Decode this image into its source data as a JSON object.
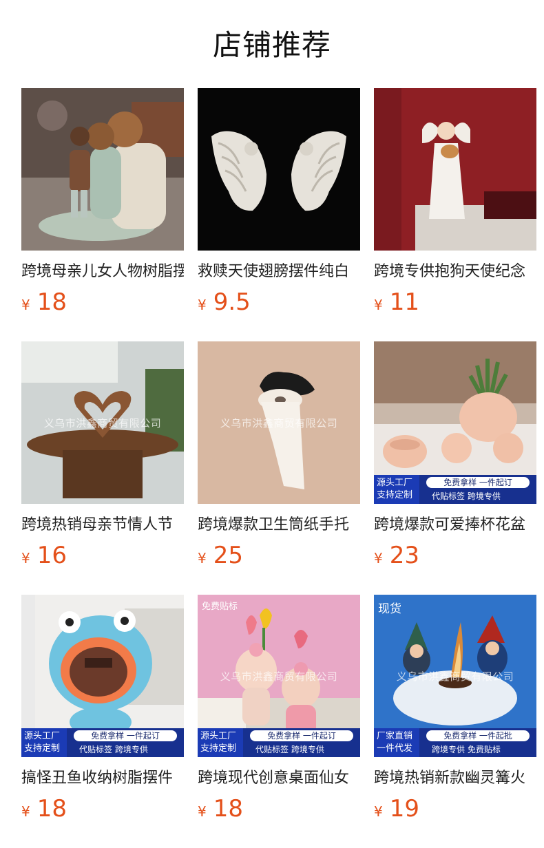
{
  "header": {
    "title": "店铺推荐"
  },
  "currency": "¥",
  "products": [
    {
      "title": "跨境母亲儿女人物树脂摆件",
      "price": "18"
    },
    {
      "title": "救赎天使翅膀摆件纯白",
      "price": "9.5"
    },
    {
      "title": "跨境专供抱狗天使纪念",
      "price": "11"
    },
    {
      "title": "跨境热销母亲节情人节",
      "price": "16",
      "watermark": "义乌市洪鑫商贸有限公司"
    },
    {
      "title": "跨境爆款卫生筒纸手托",
      "price": "25",
      "watermark": "义乌市洪鑫商贸有限公司"
    },
    {
      "title": "跨境爆款可爱捧杯花盆",
      "price": "23",
      "badge": {
        "left_top": "源头工厂",
        "left_bottom": "支持定制",
        "pill": "免费拿样  一件起订",
        "sub": "代贴标签  跨境专供"
      }
    },
    {
      "title": "搞怪丑鱼收纳树脂摆件",
      "price": "18",
      "badge": {
        "left_top": "源头工厂",
        "left_bottom": "支持定制",
        "pill": "免费拿样  一件起订",
        "sub": "代贴标签  跨境专供"
      }
    },
    {
      "title": "跨境现代创意桌面仙女",
      "price": "18",
      "corner": "免费贴标",
      "watermark": "义乌市洪鑫商贸有限公司",
      "badge": {
        "left_top": "源头工厂",
        "left_bottom": "支持定制",
        "pill": "免费拿样  一件起订",
        "sub": "代贴标签  跨境专供"
      }
    },
    {
      "title": "跨境热销新款幽灵篝火",
      "price": "19",
      "corner": "现货",
      "watermark": "义乌市洪鑫商贸有限公司",
      "badge": {
        "left_top": "厂家直销",
        "left_bottom": "一件代发",
        "pill": "免费拿样  一件起批",
        "sub": "跨境专供  免费贴标"
      }
    }
  ]
}
